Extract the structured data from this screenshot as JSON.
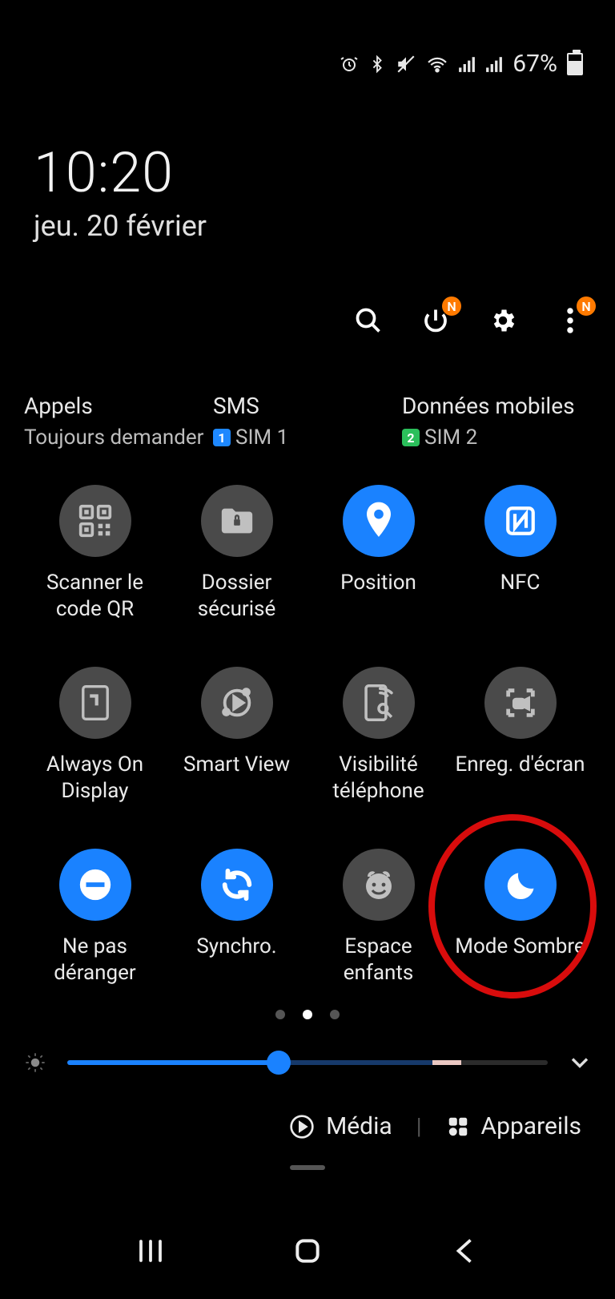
{
  "status": {
    "battery_percent": "67%",
    "icons": [
      "alarm-icon",
      "bluetooth-icon",
      "mute-vibrate-icon",
      "wifi-icon",
      "signal-icon",
      "signal-icon"
    ]
  },
  "clock": {
    "time": "10:20",
    "date": "jeu. 20 février"
  },
  "actions": {
    "search": "search",
    "power_badge": "N",
    "more_badge": "N"
  },
  "sim": {
    "calls": {
      "title": "Appels",
      "sub": "Toujours demander"
    },
    "sms": {
      "title": "SMS",
      "sub": "SIM 1",
      "chip": "1",
      "chip_color": "blue"
    },
    "data": {
      "title": "Données mobiles",
      "sub": "SIM 2",
      "chip": "2",
      "chip_color": "green"
    }
  },
  "tiles": [
    {
      "id": "qr",
      "label": "Scanner le code QR",
      "on": false,
      "icon": "qr-icon"
    },
    {
      "id": "secure",
      "label": "Dossier sécurisé",
      "on": false,
      "icon": "folder-lock-icon"
    },
    {
      "id": "location",
      "label": "Position",
      "on": true,
      "icon": "location-icon"
    },
    {
      "id": "nfc",
      "label": "NFC",
      "on": true,
      "icon": "nfc-icon"
    },
    {
      "id": "aod",
      "label": "Always On Display",
      "on": false,
      "icon": "aod-icon"
    },
    {
      "id": "smartview",
      "label": "Smart View",
      "on": false,
      "icon": "smartview-icon"
    },
    {
      "id": "phonevis",
      "label": "Visibilité téléphone",
      "on": false,
      "icon": "phone-visibility-icon"
    },
    {
      "id": "screenrec",
      "label": "Enreg. d'écran",
      "on": false,
      "icon": "screen-record-icon"
    },
    {
      "id": "dnd",
      "label": "Ne pas déranger",
      "on": true,
      "icon": "dnd-icon"
    },
    {
      "id": "sync",
      "label": "Synchro.",
      "on": true,
      "icon": "sync-icon"
    },
    {
      "id": "kids",
      "label": "Espace enfants",
      "on": false,
      "icon": "kids-icon"
    },
    {
      "id": "dark",
      "label": "Mode Sombre",
      "on": true,
      "icon": "moon-icon",
      "highlighted": true
    }
  ],
  "pager": {
    "pages": 3,
    "active": 1
  },
  "brightness": {
    "percent": 44
  },
  "footer": {
    "media": "Média",
    "devices": "Appareils"
  },
  "highlight_note": "red-circle-annotation"
}
